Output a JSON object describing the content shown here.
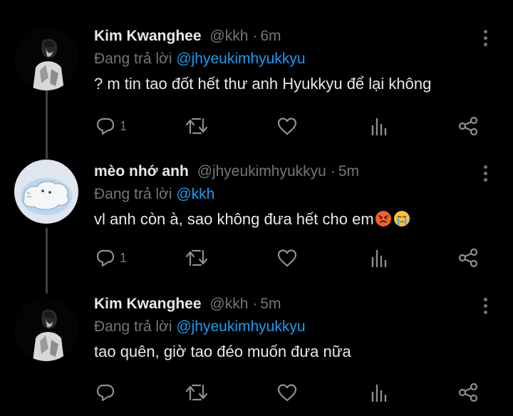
{
  "tweets": [
    {
      "name": "Kim Kwanghee",
      "handle": "@kkh",
      "time": "6m",
      "reply_prefix": "Đang trả lời",
      "reply_to": "@jhyeukimhyukkyu",
      "text": "? m tin tao đốt hết thư anh Hyukkyu để lại không",
      "reply_count": "1"
    },
    {
      "name": "mèo nhớ anh",
      "handle": "@jhyeukimhyukkyu",
      "time": "5m",
      "reply_prefix": "Đang trả lời",
      "reply_to": "@kkh",
      "text": "vl anh còn à, sao không đưa hết cho em",
      "emoji": [
        "angry-face",
        "crying-face"
      ],
      "reply_count": "1"
    },
    {
      "name": "Kim Kwanghee",
      "handle": "@kkh",
      "time": "5m",
      "reply_prefix": "Đang trả lời",
      "reply_to": "@jhyeukimhyukkyu",
      "text": "tao quên, giờ tao đéo muốn đưa nữa",
      "reply_count": ""
    }
  ],
  "icons": [
    "reply-icon",
    "retweet-icon",
    "like-icon",
    "analytics-icon",
    "share-icon",
    "more-icon"
  ],
  "colors": {
    "background": "#000000",
    "text": "#e7e9ea",
    "muted": "#71767b",
    "link": "#1d9bf0",
    "thread_line": "#3d4045"
  }
}
